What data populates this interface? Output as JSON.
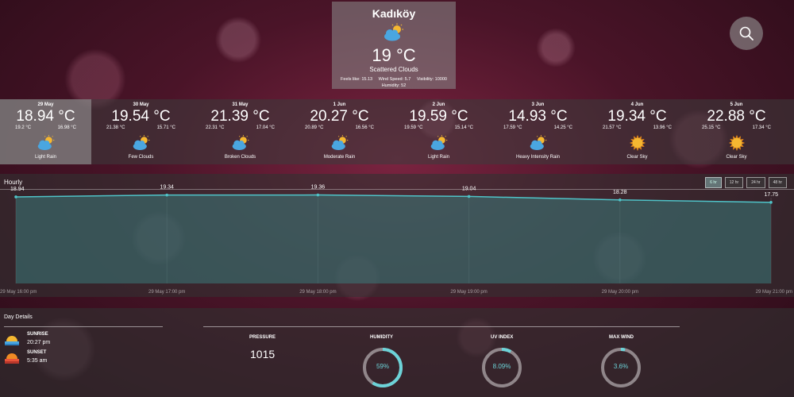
{
  "current": {
    "city": "Kadıköy",
    "temp": "19 °C",
    "description": "Scattered Clouds",
    "feels_like": "Feels like: 15.13",
    "wind_speed": "Wind Speed: 5.7",
    "visibility": "Visibility: 10000",
    "humidity": "Humidity: 52",
    "icon": "partly-cloudy-icon"
  },
  "search": {
    "icon": "search-icon"
  },
  "forecast": [
    {
      "date": "29 May",
      "temp": "18.94 °C",
      "max": "19.2 °C",
      "min": "16.98 °C",
      "desc": "Light Rain",
      "icon": "partly-cloudy-icon"
    },
    {
      "date": "30 May",
      "temp": "19.54 °C",
      "max": "21.38 °C",
      "min": "15.71 °C",
      "desc": "Few Clouds",
      "icon": "partly-cloudy-icon"
    },
    {
      "date": "31 May",
      "temp": "21.39 °C",
      "max": "22.31 °C",
      "min": "17.04 °C",
      "desc": "Broken Clouds",
      "icon": "partly-cloudy-icon"
    },
    {
      "date": "1 Jun",
      "temp": "20.27 °C",
      "max": "20.89 °C",
      "min": "16.56 °C",
      "desc": "Moderate Rain",
      "icon": "partly-cloudy-icon"
    },
    {
      "date": "2 Jun",
      "temp": "19.59 °C",
      "max": "19.59 °C",
      "min": "15.14 °C",
      "desc": "Light Rain",
      "icon": "partly-cloudy-icon"
    },
    {
      "date": "3 Jun",
      "temp": "14.93 °C",
      "max": "17.59 °C",
      "min": "14.25 °C",
      "desc": "Heavy Intensity Rain",
      "icon": "partly-cloudy-icon"
    },
    {
      "date": "4 Jun",
      "temp": "19.34 °C",
      "max": "21.57 °C",
      "min": "13.96 °C",
      "desc": "Clear Sky",
      "icon": "sun-icon"
    },
    {
      "date": "5 Jun",
      "temp": "22.88 °C",
      "max": "25.15 °C",
      "min": "17.34 °C",
      "desc": "Clear Sky",
      "icon": "sun-icon"
    }
  ],
  "hourly": {
    "title": "Hourly",
    "ranges": [
      "6 hr",
      "12 hr",
      "24 hr",
      "48 hr"
    ],
    "active_range": "6 hr"
  },
  "chart_data": {
    "type": "area",
    "x": [
      "29 May 16:00 pm",
      "29 May 17:00 pm",
      "29 May 18:00 pm",
      "29 May 19:00 pm",
      "29 May 20:00 pm",
      "29 May 21:00 pm"
    ],
    "values": [
      18.94,
      19.34,
      19.36,
      19.04,
      18.28,
      17.75
    ],
    "labels": [
      "18.94",
      "19.34",
      "19.36",
      "19.04",
      "18.28",
      "17.75"
    ],
    "line_color": "#4fc3c8",
    "fill_color": "#3a7a7a"
  },
  "details": {
    "title": "Day Details",
    "sunrise_label": "SUNRISE",
    "sunrise_value": "20:27 pm",
    "sunset_label": "SUNSET",
    "sunset_value": "5:35 am",
    "pressure_label": "PRESSURE",
    "pressure_value": "1015",
    "humidity_label": "HUMIDITY",
    "humidity_value": "59%",
    "humidity_fraction": 0.59,
    "uv_label": "UV INDEX",
    "uv_value": "8.09%",
    "uv_fraction": 0.0809,
    "wind_label": "MAX WIND",
    "wind_value": "3.6%",
    "wind_fraction": 0.036
  }
}
